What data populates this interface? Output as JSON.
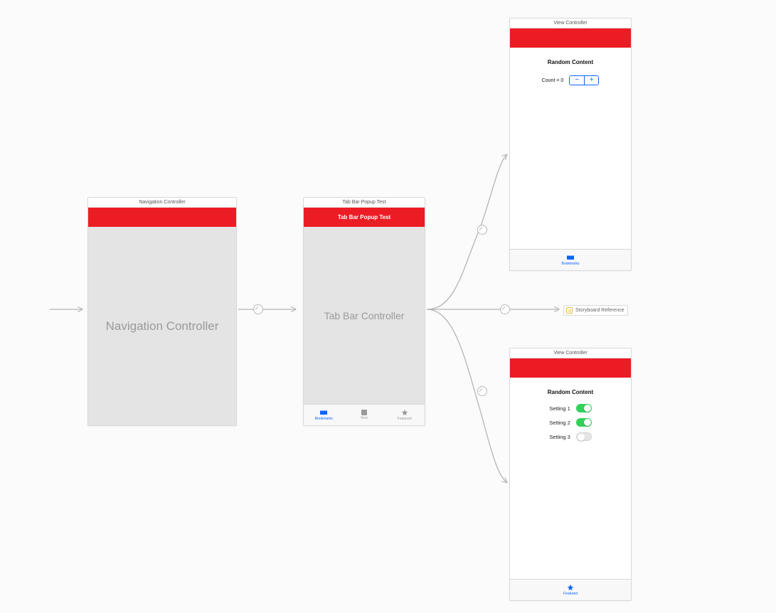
{
  "scenes": {
    "nav_controller": {
      "title_bar": "Navigation Controller",
      "center_label": "Navigation Controller"
    },
    "tab_bar_controller": {
      "title_bar": "Tab Bar Popup Test",
      "nav_title": "Tab Bar Popup Test",
      "center_label": "Tab Bar Controller",
      "tabs": [
        {
          "label": "Bookmarks",
          "icon": "book-icon",
          "active": true
        },
        {
          "label": "Item",
          "icon": "square-icon",
          "active": false
        },
        {
          "label": "Featured",
          "icon": "star-icon",
          "active": false
        }
      ]
    },
    "vc_top": {
      "title_bar": "View Controller",
      "heading": "Random Content",
      "count_label": "Count = 0",
      "stepper": {
        "minus": "−",
        "plus": "+"
      },
      "tab": {
        "label": "Bookmarks",
        "icon": "book-icon"
      }
    },
    "vc_bottom": {
      "title_bar": "View Controller",
      "heading": "Random Content",
      "settings": [
        {
          "label": "Setting 1",
          "on": true
        },
        {
          "label": "Setting 2",
          "on": true
        },
        {
          "label": "Setting 3",
          "on": false
        }
      ],
      "tab": {
        "label": "Featured",
        "icon": "star-icon"
      }
    },
    "storyboard_ref": {
      "label": "Storyboard Reference"
    }
  },
  "colors": {
    "navbar_bg": "#ec1c24",
    "tint_blue": "#0b64ff",
    "toggle_on": "#32d15a"
  }
}
